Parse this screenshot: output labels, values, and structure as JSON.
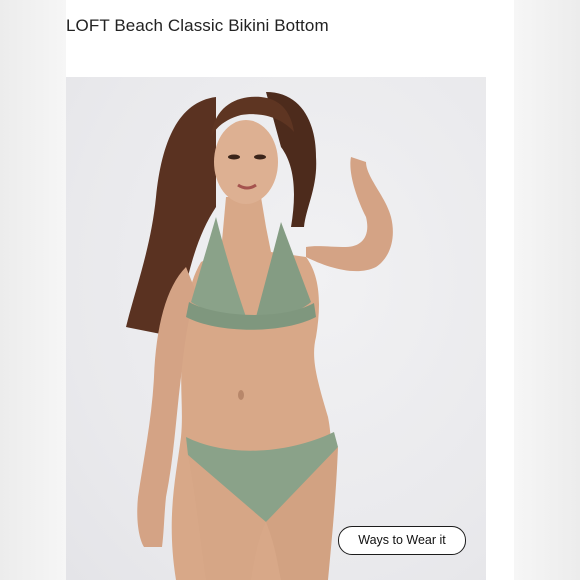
{
  "product": {
    "title": "LOFT Beach Classic Bikini Bottom"
  },
  "image": {
    "subject_icon": "model-photo",
    "swimsuit_color": "#8aa289",
    "background_color": "#ececef"
  },
  "actions": {
    "ways_to_wear_label": "Ways to Wear it"
  }
}
